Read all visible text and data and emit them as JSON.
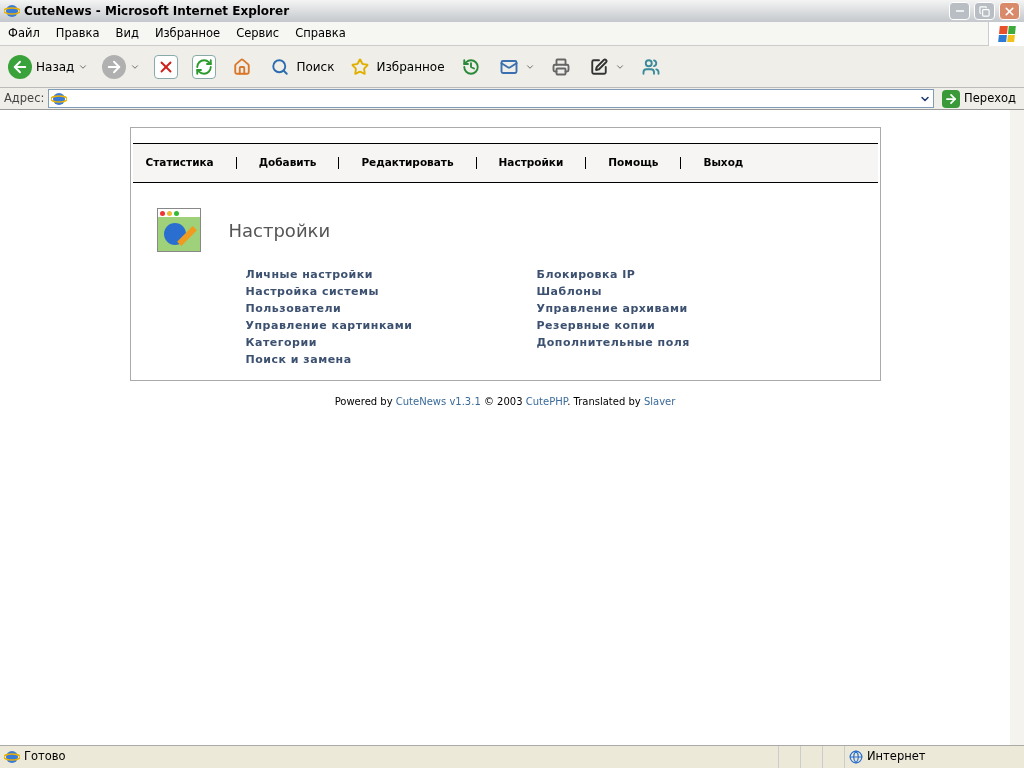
{
  "window": {
    "title": "CuteNews - Microsoft Internet Explorer"
  },
  "menu": [
    "Файл",
    "Правка",
    "Вид",
    "Избранное",
    "Сервис",
    "Справка"
  ],
  "toolbar": [
    {
      "kind": "back",
      "label": "Назад",
      "disabled": false
    },
    {
      "kind": "forward",
      "disabled": true
    },
    {
      "kind": "stop"
    },
    {
      "kind": "refresh"
    },
    {
      "kind": "home"
    },
    {
      "kind": "search",
      "label": "Поиск"
    },
    {
      "kind": "favorites",
      "label": "Избранное"
    },
    {
      "kind": "history"
    },
    {
      "kind": "mail"
    },
    {
      "kind": "print"
    },
    {
      "kind": "edit"
    },
    {
      "kind": "messenger"
    }
  ],
  "address": {
    "label": "Адрес:",
    "go": "Переход"
  },
  "nav": [
    "Статистика",
    "Добавить",
    "Редактировать",
    "Настройки",
    "Помощь",
    "Выход"
  ],
  "heading": "Настройки",
  "links_left": [
    "Личные настройки",
    "Настройка системы",
    "Пользователи",
    "Управление картинками",
    "Категории",
    "Поиск и замена"
  ],
  "links_right": [
    "Блокировка IP",
    "Шаблоны",
    "Управление архивами",
    "Резервные копии",
    "Дополнительные поля"
  ],
  "footer": [
    {
      "text": "Powered by ",
      "link": false
    },
    {
      "text": "CuteNews v1.3.1",
      "link": true
    },
    {
      "text": " © 2003 ",
      "link": false
    },
    {
      "text": "CutePHP",
      "link": true
    },
    {
      "text": ". Translated by ",
      "link": false
    },
    {
      "text": "Slaver",
      "link": true
    }
  ],
  "status": {
    "text": "Готово",
    "zone": "Интернет"
  }
}
